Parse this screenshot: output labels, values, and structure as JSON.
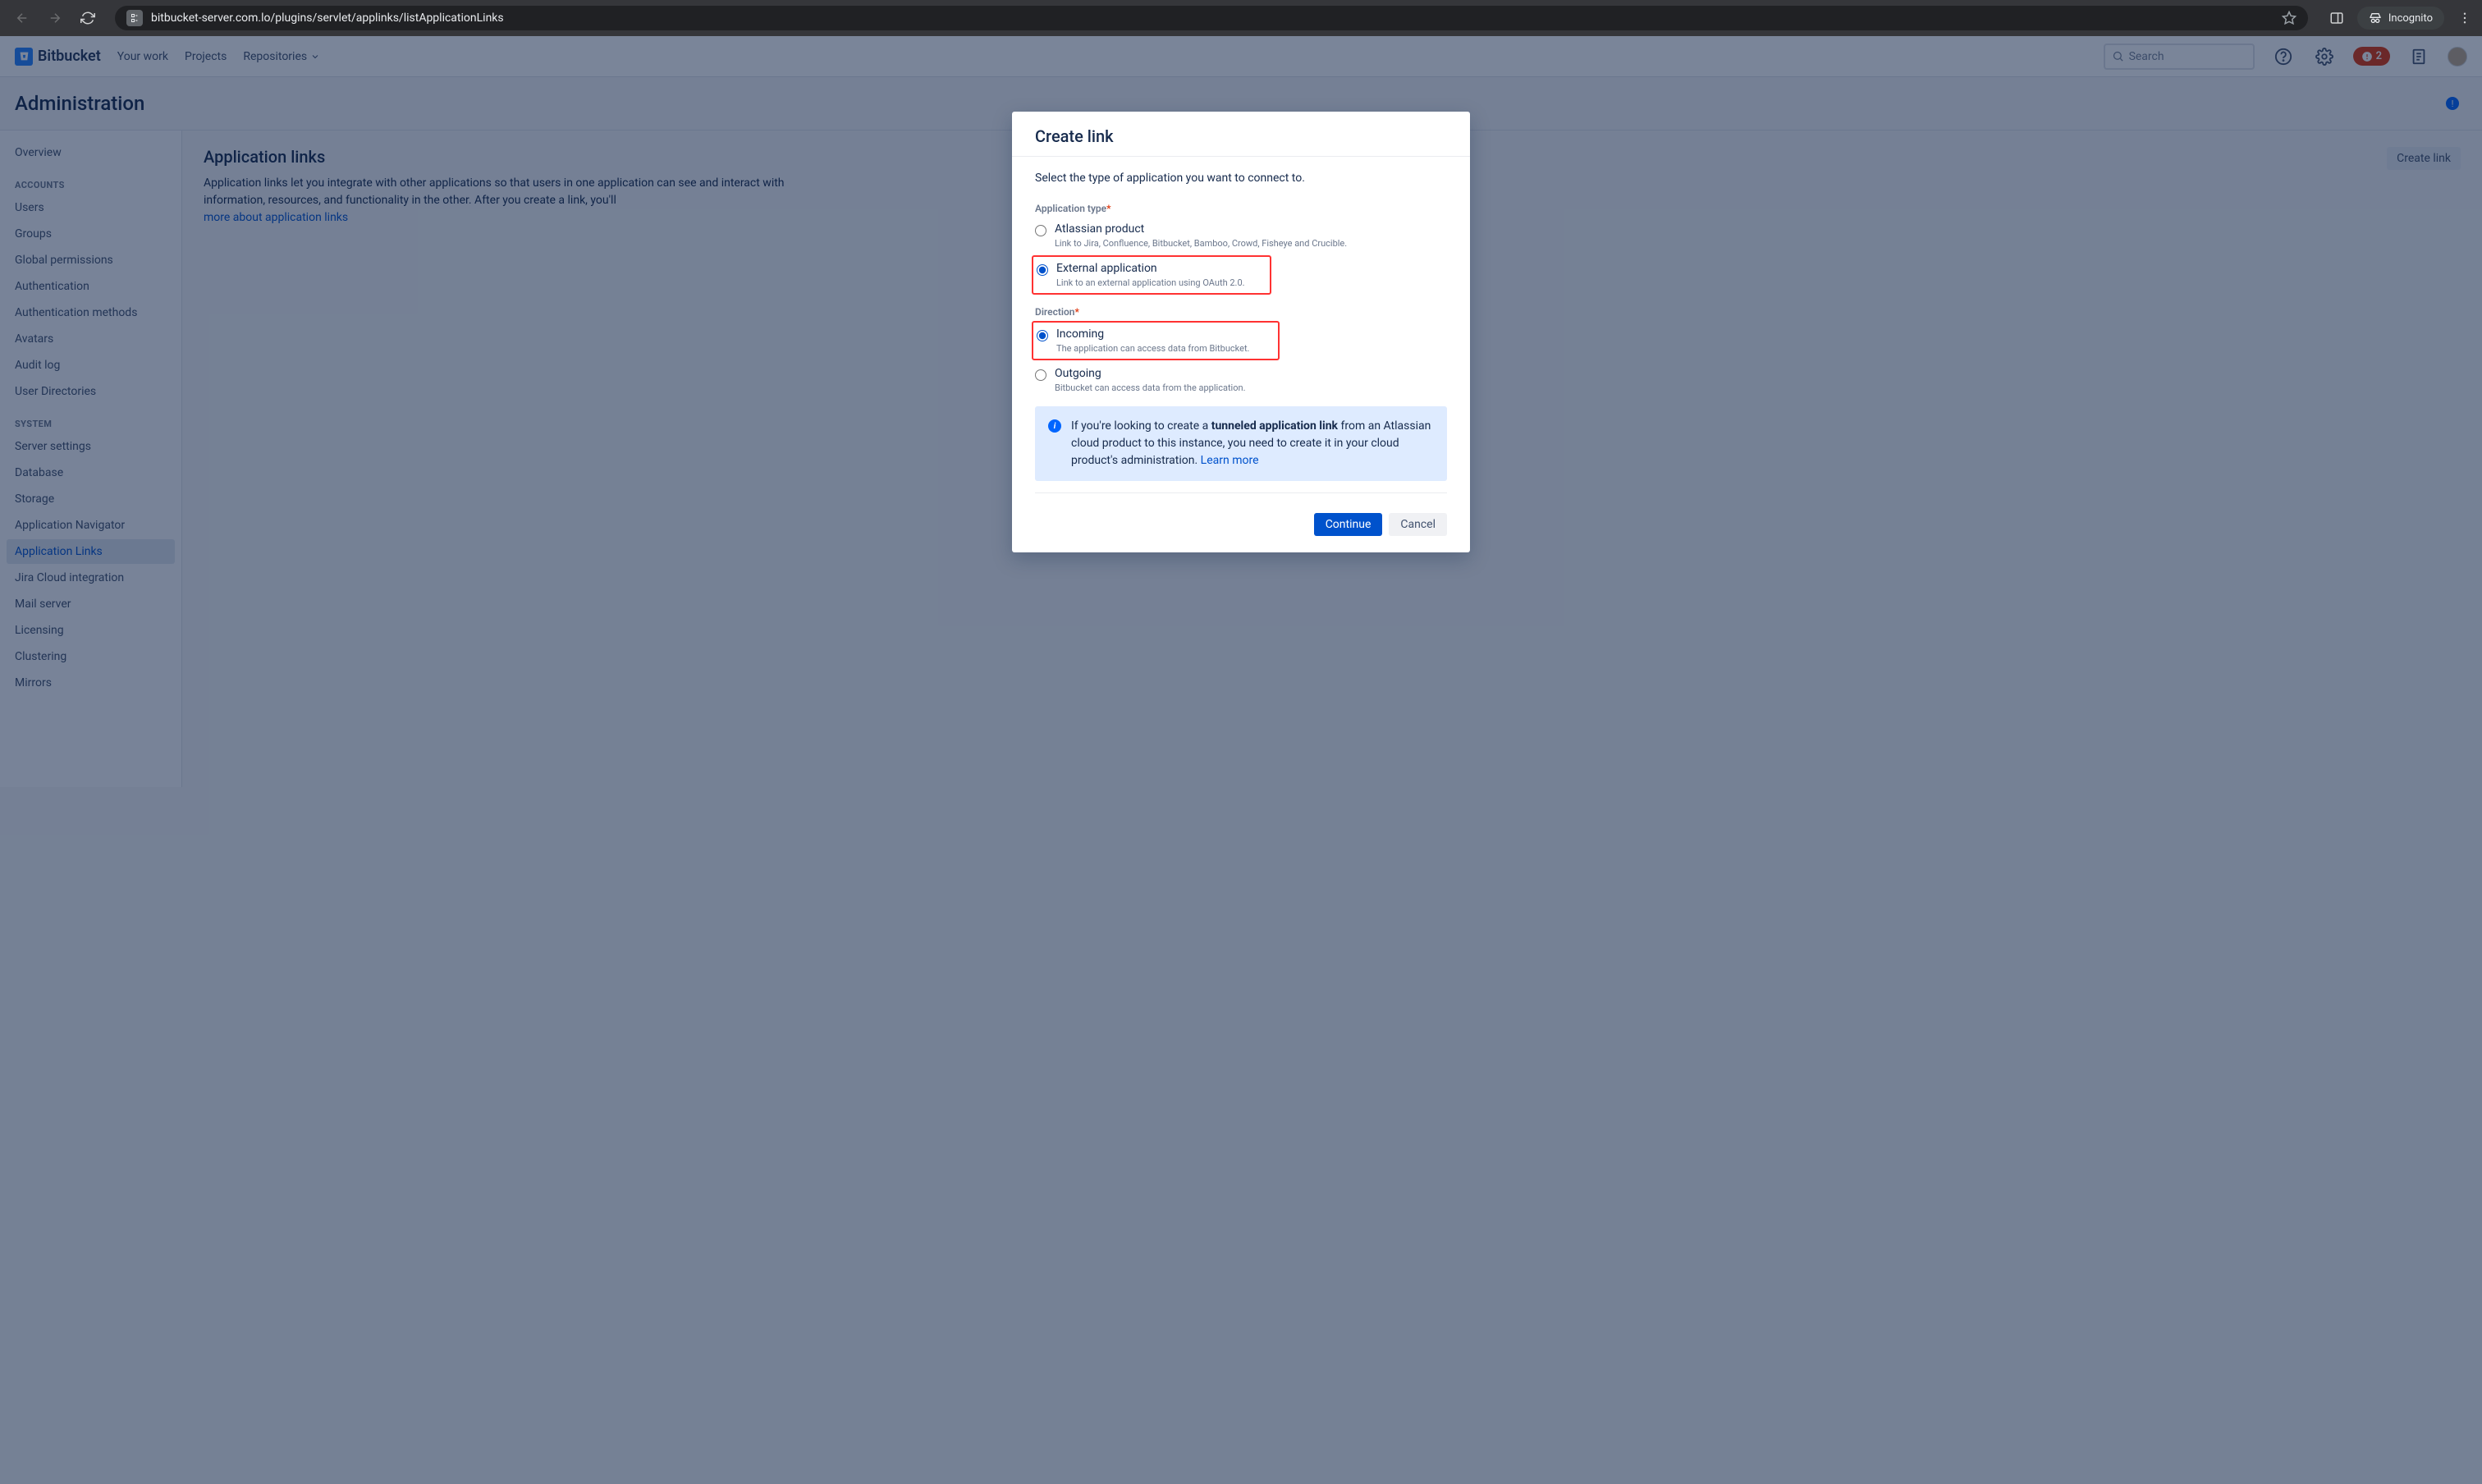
{
  "browser": {
    "url": "bitbucket-server.com.lo/plugins/servlet/applinks/listApplicationLinks",
    "incognito_label": "Incognito"
  },
  "nav": {
    "brand": "Bitbucket",
    "links": {
      "your_work": "Your work",
      "projects": "Projects",
      "repositories": "Repositories"
    },
    "search_placeholder": "Search",
    "notif_count": "2"
  },
  "admin": {
    "title": "Administration"
  },
  "sidebar": {
    "overview": "Overview",
    "accounts_heading": "ACCOUNTS",
    "accounts": [
      "Users",
      "Groups",
      "Global permissions",
      "Authentication",
      "Authentication methods",
      "Avatars",
      "Audit log",
      "User Directories"
    ],
    "system_heading": "SYSTEM",
    "system": [
      "Server settings",
      "Database",
      "Storage",
      "Application Navigator",
      "Application Links",
      "Jira Cloud integration",
      "Mail server",
      "Licensing",
      "Clustering",
      "Mirrors"
    ]
  },
  "page": {
    "title": "Application links",
    "desc_text": "Application links let you integrate with other applications so that users in one application can see and interact with information, resources, and functionality in the other. After you create a link, you'll ",
    "desc_link": "more about application links",
    "create_btn": "Create link"
  },
  "dialog": {
    "title": "Create link",
    "subtitle": "Select the type of application you want to connect to.",
    "app_type_label": "Application type",
    "opt_atlassian_label": "Atlassian product",
    "opt_atlassian_desc": "Link to Jira, Confluence, Bitbucket, Bamboo, Crowd, Fisheye and Crucible.",
    "opt_external_label": "External application",
    "opt_external_desc": "Link to an external application using OAuth 2.0.",
    "direction_label": "Direction",
    "opt_incoming_label": "Incoming",
    "opt_incoming_desc": "The application can access data from Bitbucket.",
    "opt_outgoing_label": "Outgoing",
    "opt_outgoing_desc": "Bitbucket can access data from the application.",
    "info_pre": "If you're looking to create a ",
    "info_bold": "tunneled application link",
    "info_post": " from an Atlassian cloud product to this instance, you need to create it in your cloud product's administration. ",
    "info_learn": "Learn more",
    "continue": "Continue",
    "cancel": "Cancel"
  }
}
